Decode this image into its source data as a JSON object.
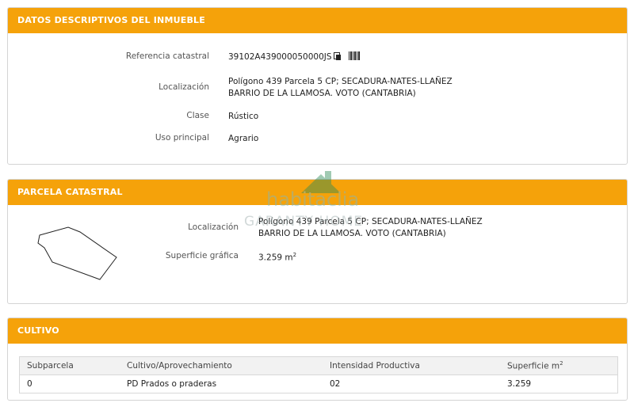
{
  "datos": {
    "title": "DATOS DESCRIPTIVOS DEL INMUEBLE",
    "ref_label": "Referencia catastral",
    "ref_value": "39102A439000050000JS",
    "loc_label": "Localización",
    "loc_line1": "Polígono 439 Parcela 5 CP; SECADURA-NATES-LLAÑEZ",
    "loc_line2": "BARRIO DE LA LLAMOSA. VOTO (CANTABRIA)",
    "clase_label": "Clase",
    "clase_value": "Rústico",
    "uso_label": "Uso principal",
    "uso_value": "Agrario"
  },
  "parcela": {
    "title": "PARCELA CATASTRAL",
    "loc_label": "Localización",
    "loc_line1": "Polígono 439 Parcela 5 CP; SECADURA-NATES-LLAÑEZ",
    "loc_line2": "BARRIO DE LA LLAMOSA. VOTO (CANTABRIA)",
    "sup_label": "Superficie gráfica",
    "sup_value": "3.259 m",
    "sup_unit_sup": "2"
  },
  "cultivo": {
    "title": "CULTIVO",
    "headers": [
      "Subparcela",
      "Cultivo/Aprovechamiento",
      "Intensidad Productiva",
      "Superficie m"
    ],
    "header_sup": "2",
    "rows": [
      [
        "0",
        "PD Prados o praderas",
        "02",
        "3.259"
      ]
    ]
  },
  "watermark": {
    "line1": "habitaclia",
    "line2": "GARANTY HOME"
  },
  "icons": [
    "copy-icon",
    "barcode-icon"
  ]
}
